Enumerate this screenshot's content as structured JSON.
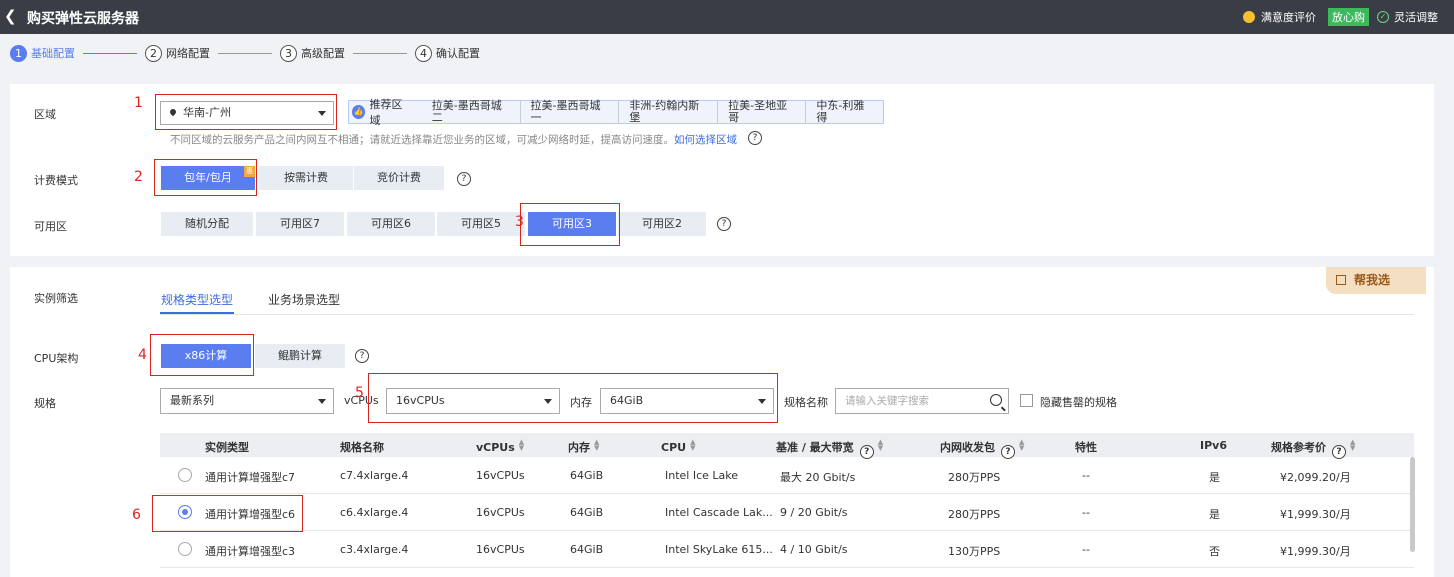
{
  "header": {
    "title": "购买弹性云服务器",
    "satisfaction": "满意度评价",
    "badge": "放心购",
    "flexible": "灵活调整"
  },
  "steps": [
    {
      "num": "1",
      "label": "基础配置",
      "active": true
    },
    {
      "num": "2",
      "label": "网络配置",
      "active": false
    },
    {
      "num": "3",
      "label": "高级配置",
      "active": false
    },
    {
      "num": "4",
      "label": "确认配置",
      "active": false
    }
  ],
  "basic": {
    "region_label": "区域",
    "region_value": "华南-广州",
    "recommend_label": "推荐区域",
    "recommend_regions": [
      "拉美-墨西哥城二",
      "拉美-墨西哥城一",
      "非洲-约翰内斯堡",
      "拉美-圣地亚哥",
      "中东-利雅得"
    ],
    "hint_text": "不同区域的云服务产品之间内网互不相通；请就近选择靠近您业务的区域，可减少网络时延，提高访问速度。",
    "hint_link": "如何选择区域",
    "billing_label": "计费模式",
    "billing_options": [
      "包年/包月",
      "按需计费",
      "竞价计费"
    ],
    "az_label": "可用区",
    "az_options": [
      "随机分配",
      "可用区7",
      "可用区6",
      "可用区5",
      "可用区3",
      "可用区2"
    ]
  },
  "instance": {
    "filter_label": "实例筛选",
    "tabs": [
      "规格类型选型",
      "业务场景选型"
    ],
    "help_me": "帮我选",
    "cpu_label": "CPU架构",
    "cpu_options": [
      "x86计算",
      "鲲鹏计算"
    ],
    "spec_label": "规格",
    "series_value": "最新系列",
    "vcpus_label": "vCPUs",
    "vcpus_value": "16vCPUs",
    "memory_label": "内存",
    "memory_value": "64GiB",
    "spec_name_label": "规格名称",
    "search_placeholder": "请输入关键字搜索",
    "hide_soldout": "隐藏售罄的规格"
  },
  "table": {
    "headers": [
      "实例类型",
      "规格名称",
      "vCPUs",
      "内存",
      "CPU",
      "基准 / 最大带宽",
      "内网收发包",
      "特性",
      "IPv6",
      "规格参考价"
    ],
    "rows": [
      {
        "type": "通用计算增强型c7",
        "name": "c7.4xlarge.4",
        "vcpus": "16vCPUs",
        "memory": "64GiB",
        "cpu": "Intel Ice Lake",
        "bandwidth": "最大 20 Gbit/s",
        "pps": "280万PPS",
        "feature": "--",
        "ipv6": "是",
        "price": "¥2,099.20/月",
        "selected": false
      },
      {
        "type": "通用计算增强型c6",
        "name": "c6.4xlarge.4",
        "vcpus": "16vCPUs",
        "memory": "64GiB",
        "cpu": "Intel Cascade Lak...",
        "bandwidth": "9 / 20 Gbit/s",
        "pps": "280万PPS",
        "feature": "--",
        "ipv6": "是",
        "price": "¥1,999.30/月",
        "selected": true
      },
      {
        "type": "通用计算增强型c3",
        "name": "c3.4xlarge.4",
        "vcpus": "16vCPUs",
        "memory": "64GiB",
        "cpu": "Intel SkyLake 615...",
        "bandwidth": "4 / 10 Gbit/s",
        "pps": "130万PPS",
        "feature": "--",
        "ipv6": "否",
        "price": "¥1,999.30/月",
        "selected": false
      }
    ]
  },
  "annotations": [
    "1",
    "2",
    "3",
    "4",
    "5",
    "6"
  ],
  "colors": {
    "accent": "#5a7df0",
    "header_bg": "#3a3d45",
    "annotation_red": "#d9251d",
    "badge_green": "#3bb95c"
  }
}
